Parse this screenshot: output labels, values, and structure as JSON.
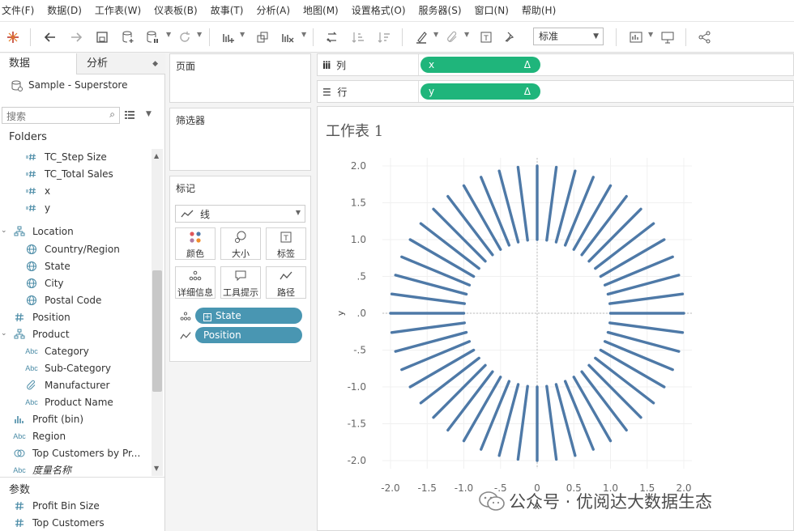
{
  "menu": [
    "文件(F)",
    "数据(D)",
    "工作表(W)",
    "仪表板(B)",
    "故事(T)",
    "分析(A)",
    "地图(M)",
    "设置格式(O)",
    "服务器(S)",
    "窗口(N)",
    "帮助(H)"
  ],
  "toolbar": {
    "standard_select": "标准"
  },
  "left_panel": {
    "tabs": {
      "data": "数据",
      "analysis": "分析"
    },
    "datasource": "Sample - Superstore",
    "search_placeholder": "搜索",
    "folders_header": "Folders",
    "fields": [
      {
        "label": "TC_Step Size",
        "icon": "=#"
      },
      {
        "label": "TC_Total Sales",
        "icon": "=#"
      },
      {
        "label": "x",
        "icon": "=#"
      },
      {
        "label": "y",
        "icon": "=#"
      },
      {
        "label": "Location",
        "icon": "hierarchy"
      },
      {
        "label": "Country/Region",
        "icon": "globe"
      },
      {
        "label": "State",
        "icon": "globe"
      },
      {
        "label": "City",
        "icon": "globe"
      },
      {
        "label": "Postal Code",
        "icon": "globe"
      },
      {
        "label": "Position",
        "icon": "#"
      },
      {
        "label": "Product",
        "icon": "hierarchy"
      },
      {
        "label": "Category",
        "icon": "Abc"
      },
      {
        "label": "Sub-Category",
        "icon": "Abc"
      },
      {
        "label": "Manufacturer",
        "icon": "paperclip"
      },
      {
        "label": "Product Name",
        "icon": "Abc"
      },
      {
        "label": "Profit (bin)",
        "icon": "bin"
      },
      {
        "label": "Region",
        "icon": "Abc"
      },
      {
        "label": "Top Customers by Pr...",
        "icon": "set"
      },
      {
        "label": "度量名称",
        "icon": "Abc"
      }
    ],
    "params_header": "参数",
    "params": [
      "Profit Bin Size",
      "Top Customers"
    ]
  },
  "pages_card": {
    "title": "页面"
  },
  "filters_card": {
    "title": "筛选器"
  },
  "marks_card": {
    "title": "标记",
    "mark_type": "线",
    "buttons": [
      "颜色",
      "大小",
      "标签",
      "详细信息",
      "工具提示",
      "路径"
    ],
    "pills": [
      {
        "label": "State",
        "color": "#4996b2"
      },
      {
        "label": "Position",
        "color": "#4996b2"
      }
    ]
  },
  "columns_shelf": {
    "label": "列",
    "pill": "x",
    "pill_delta": "Δ",
    "pill_color": "#1fb57b"
  },
  "rows_shelf": {
    "label": "行",
    "pill": "y",
    "pill_delta": "Δ",
    "pill_color": "#1fb57b"
  },
  "sheet": {
    "title": "工作表 1"
  },
  "chart_data": {
    "type": "line",
    "description_lines": 48,
    "inner_radius": 1.0,
    "outer_radius": 2.0,
    "line_color": "#4e79a7",
    "xlim": [
      -2.0,
      2.0
    ],
    "ylim": [
      -2.0,
      2.0
    ],
    "xlabel": "x",
    "ylabel": "y",
    "xticks": [
      "-2.0",
      "-1.5",
      "-1.0",
      "-.5",
      "0",
      "0.5",
      "1.0",
      "1.5",
      "2.0"
    ],
    "yticks": [
      "2.0",
      "1.5",
      "1.0",
      ".5",
      ".0",
      "-.5",
      "-1.0",
      "-1.5",
      "-2.0"
    ],
    "grid": true
  },
  "watermark": "公众号 · 优阅达大数据生态"
}
